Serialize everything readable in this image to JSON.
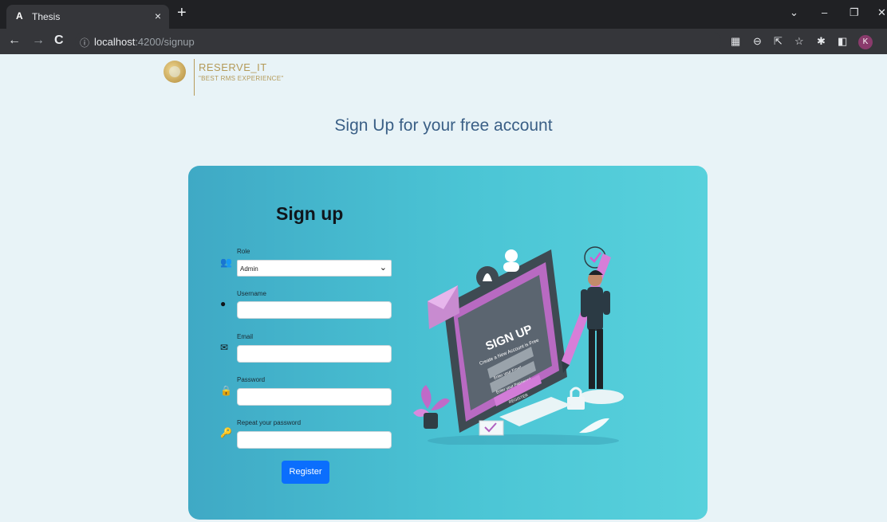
{
  "browser": {
    "tab_favicon": "A",
    "tab_title": "Thesis",
    "tab_close": "×",
    "new_tab": "+",
    "url_host": "localhost",
    "url_path": ":4200/signup",
    "profile_initial": "K"
  },
  "logo": {
    "brand": "RESERVE_IT",
    "tagline": "\"BEST RMS EXPERIENCE\""
  },
  "page": {
    "heading": "Sign Up for your free account"
  },
  "form": {
    "title": "Sign up",
    "role_label": "Role",
    "role_value": "Admin",
    "username_label": "Username",
    "email_label": "Email",
    "password_label": "Password",
    "repeat_password_label": "Repeat your password",
    "register_label": "Register"
  },
  "illustration": {
    "headline": "SIGN UP",
    "subline": "Create a New Account is Free",
    "field1": "Enter your Email",
    "field2": "Enter your Password",
    "button": "REGISTER"
  },
  "colors": {
    "page_bg": "#e8f3f7",
    "card_gradient_start": "#3fa9c5",
    "card_gradient_end": "#58d1dc",
    "heading": "#3a5f86",
    "button": "#0b6efd",
    "brand_gold": "#b49a58"
  },
  "icons": {
    "role": "users-icon",
    "username": "user-icon",
    "email": "envelope-icon",
    "password": "lock-icon",
    "repeat_password": "key-icon"
  }
}
